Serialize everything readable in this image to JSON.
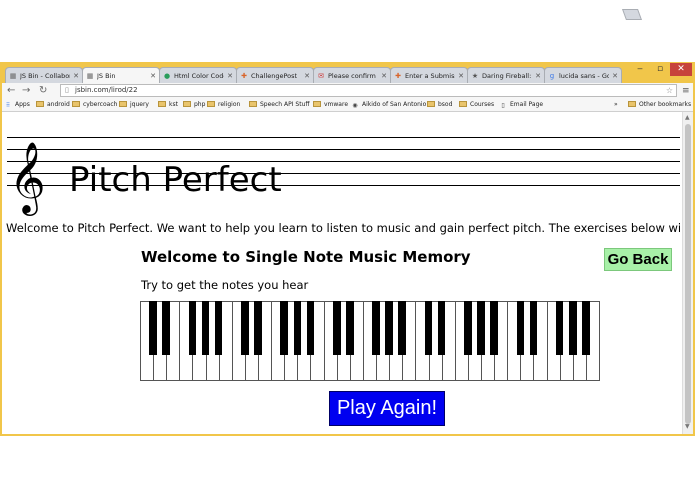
{
  "browser": {
    "tabs": [
      {
        "label": "JS Bin - Collaborat",
        "icon": "jsbin-icon",
        "active": false
      },
      {
        "label": "JS Bin",
        "icon": "jsbin-icon",
        "active": true
      },
      {
        "label": "Html Color Codes",
        "icon": "color-icon",
        "active": false
      },
      {
        "label": "ChallengePost",
        "icon": "challengepost-icon",
        "active": false
      },
      {
        "label": "Please confirm yo",
        "icon": "gmail-icon",
        "active": false
      },
      {
        "label": "Enter a Submissio",
        "icon": "challengepost-icon",
        "active": false
      },
      {
        "label": "Daring Fireball: M",
        "icon": "fireball-icon",
        "active": false
      },
      {
        "label": "lucida sans - Goo",
        "icon": "google-icon",
        "active": false
      }
    ],
    "url": "jsbin.com/lirod/22",
    "bookmarks": [
      {
        "label": "Apps",
        "kind": "apps"
      },
      {
        "label": "android",
        "kind": "folder"
      },
      {
        "label": "cybercoach",
        "kind": "folder"
      },
      {
        "label": "jquery",
        "kind": "folder"
      },
      {
        "label": "kst",
        "kind": "folder"
      },
      {
        "label": "php",
        "kind": "folder"
      },
      {
        "label": "religion",
        "kind": "folder"
      },
      {
        "label": "Speech API Stuff",
        "kind": "folder"
      },
      {
        "label": "vmware",
        "kind": "folder"
      },
      {
        "label": "Aikido of San Antonio",
        "kind": "site"
      },
      {
        "label": "bsod",
        "kind": "folder"
      },
      {
        "label": "Courses",
        "kind": "folder"
      },
      {
        "label": "Email Page",
        "kind": "page"
      }
    ],
    "bookmarks_overflow": "»",
    "other_bookmarks": "Other bookmarks"
  },
  "page": {
    "clef": "𝄞",
    "title": "Pitch Perfect",
    "intro": "Welcome to Pitch Perfect. We want to help you learn to listen to music and gain perfect pitch. The exercises below will help.",
    "subtitle": "Welcome to Single Note Music Memory",
    "go_back": "Go Back",
    "instructions": "Try to get the notes you hear",
    "play_again": "Play Again!"
  },
  "piano": {
    "white_keys": 35,
    "black_key_pattern": [
      1,
      1,
      0,
      1,
      1,
      1,
      0
    ]
  },
  "colors": {
    "window_frame": "#f1c64a",
    "go_back_bg": "#a8f0a8",
    "play_again_bg": "#0000f0"
  }
}
